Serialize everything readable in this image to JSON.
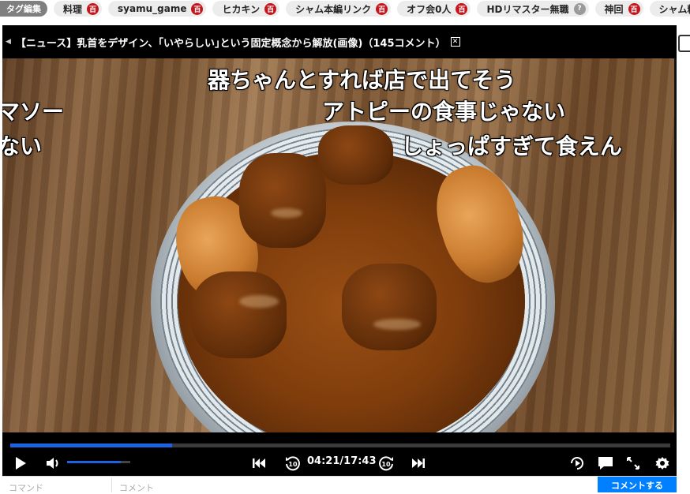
{
  "tagbar": {
    "edit_label": "タグ編集",
    "tags": [
      {
        "label": "料理",
        "badge": "百"
      },
      {
        "label": "syamu_game",
        "badge": "百"
      },
      {
        "label": "ヒカキン",
        "badge": "百"
      },
      {
        "label": "シャム本編リンク",
        "badge": "百"
      },
      {
        "label": "オフ会0人",
        "badge": "百"
      },
      {
        "label": "HDリマスター無職",
        "badge": "?"
      },
      {
        "label": "神回",
        "badge": "百"
      },
      {
        "label": "シャム料理",
        "badge": ""
      }
    ]
  },
  "player": {
    "title": "【ニュース】乳首をデザイン、｢いやらしい｣という固定概念から解放(画像)（145コメント）",
    "comments": [
      "器ちゃんとすれば店で出てそう",
      "アトピーの食事じゃない",
      "しょっぱすぎて食えん",
      "マソー",
      "ない"
    ],
    "progress": 0.245,
    "volume": 0.85,
    "time": "04:21/17:43",
    "skip_back": "10",
    "skip_forward": "10"
  },
  "comment_input": {
    "command_placeholder": "コマンド",
    "comment_placeholder": "コメント",
    "submit_label": "コメントする"
  },
  "colors": {
    "accent": "#1d63e0",
    "submit": "#0080ff",
    "badge": "#c4161c"
  },
  "icons": [
    "play-icon",
    "volume-icon",
    "skip-start-icon",
    "rewind-10-icon",
    "forward-10-icon",
    "skip-end-icon",
    "loop-icon",
    "comment-toggle-icon",
    "fullscreen-icon",
    "settings-icon"
  ]
}
